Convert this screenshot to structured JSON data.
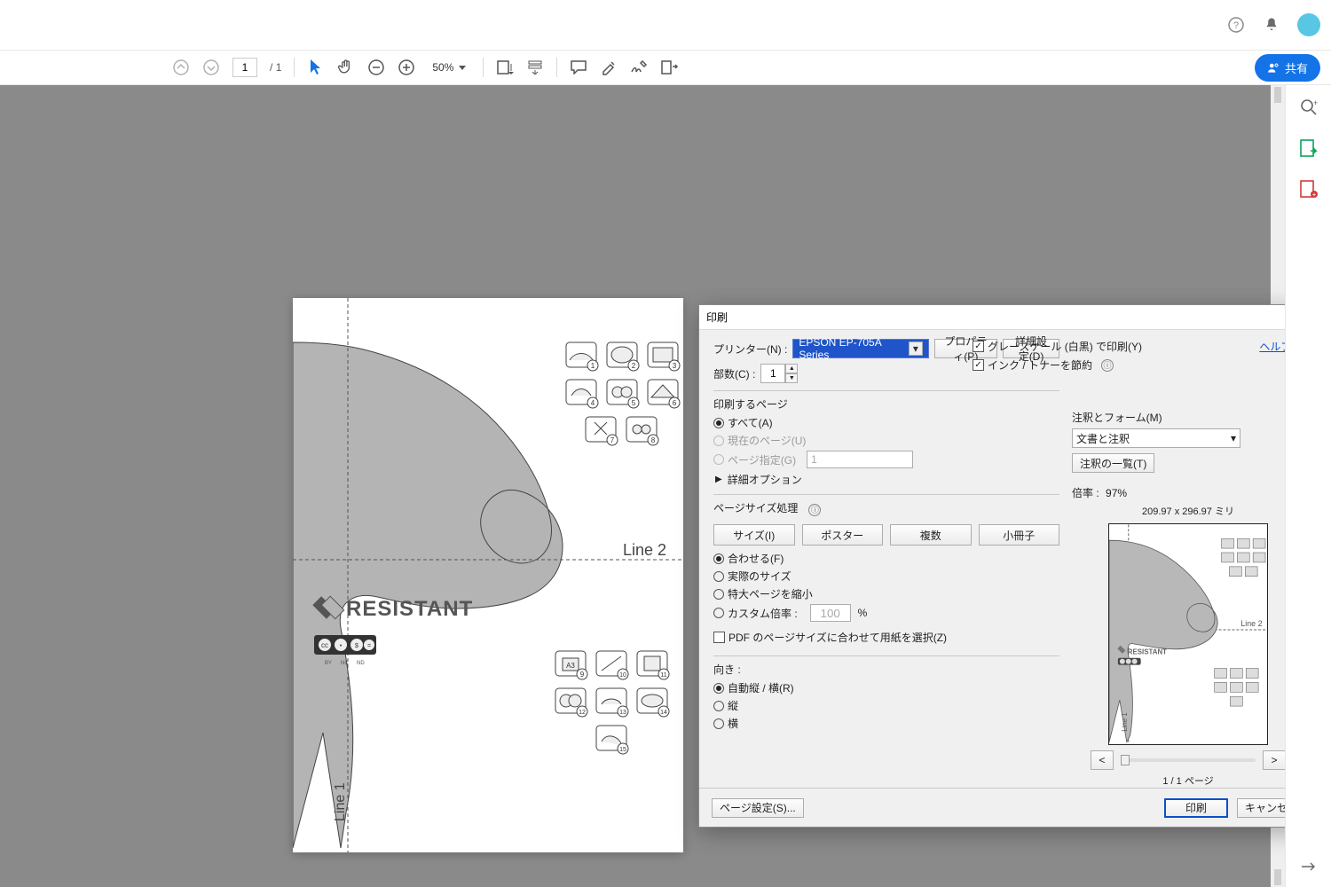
{
  "titlebar": {
    "share": "共有"
  },
  "toolbar": {
    "page_current": "1",
    "page_total_prefix": "/",
    "page_total": "1",
    "zoom_value": "50%"
  },
  "document": {
    "brand": "RESISTANT",
    "line1": "Line 1",
    "line2": "Line 2",
    "cc_labels": [
      "BY",
      "NC",
      "ND"
    ],
    "step_count": "15"
  },
  "dialog": {
    "title": "印刷",
    "printer_label": "プリンター(N) :",
    "printer_value": "EPSON EP-705A Series",
    "properties_btn": "プロパティ(P)",
    "advanced_btn": "詳細設定(D)",
    "help_link": "ヘルプ(H)",
    "info_circ": "ⓘ",
    "copies_label": "部数(C) :",
    "copies_value": "1",
    "grayscale": "グレースケール (白黒) で印刷(Y)",
    "savetoner": "インク / トナーを節約",
    "pages_title": "印刷するページ",
    "pages_all": "すべて(A)",
    "pages_current": "現在のページ(U)",
    "pages_range": "ページ指定(G)",
    "pages_range_value": "1",
    "more_options": "詳細オプション",
    "size_title": "ページサイズ処理",
    "size_tabs": {
      "size": "サイズ(I)",
      "poster": "ポスター",
      "multi": "複数",
      "booklet": "小冊子"
    },
    "fit": "合わせる(F)",
    "actual": "実際のサイズ",
    "shrink": "特大ページを縮小",
    "custom_scale": "カスタム倍率 :",
    "custom_scale_value": "100",
    "percent": "%",
    "choose_paper": "PDF のページサイズに合わせて用紙を選択(Z)",
    "orient_title": "向き :",
    "orient_auto": "自動縦 / 横(R)",
    "orient_port": "縦",
    "orient_land": "横",
    "annot_title": "注釈とフォーム(M)",
    "annot_value": "文書と注釈",
    "annot_list_btn": "注釈の一覧(T)",
    "zoom_label": "倍率 :",
    "zoom_value": "97%",
    "paper_dim": "209.97 x 296.97 ミリ",
    "nav_prev": "<",
    "nav_next": ">",
    "page_of": "1 / 1 ページ",
    "page_setup": "ページ設定(S)...",
    "print_btn": "印刷",
    "cancel_btn": "キャンセル"
  },
  "preview": {
    "brand": "RESISTANT",
    "line1": "Line 1",
    "line2": "Line 2"
  }
}
